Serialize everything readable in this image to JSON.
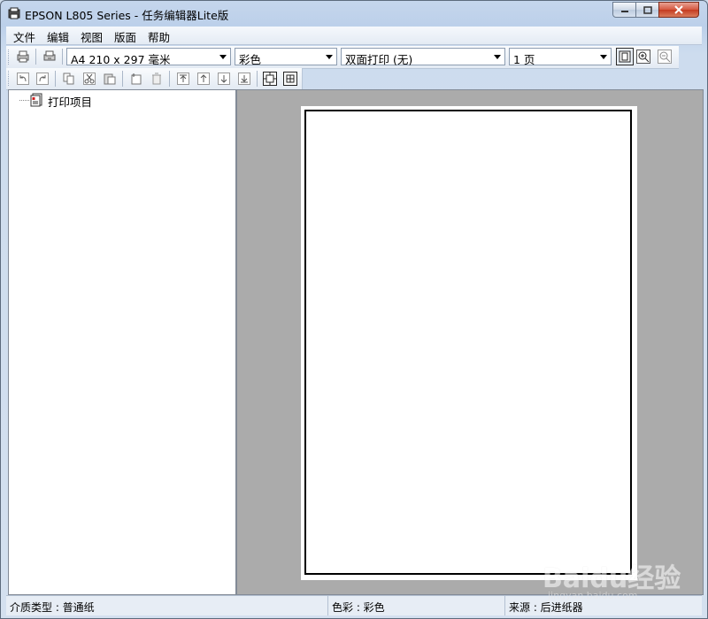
{
  "window": {
    "title": "EPSON L805 Series - 任务编辑器Lite版",
    "accent": "#c5d6ec"
  },
  "menu": {
    "items": [
      "文件",
      "编辑",
      "视图",
      "版面",
      "帮助"
    ]
  },
  "toolbar": {
    "paper_size": "A4 210 x 297 毫米",
    "color_mode": "彩色",
    "duplex": "双面打印 (无)",
    "pages": "1 页"
  },
  "tree": {
    "root_label": "打印项目"
  },
  "status": {
    "media_type": "介质类型 : 普通纸",
    "color": "色彩 : 彩色",
    "source": "来源 : 后进纸器"
  },
  "watermark": {
    "brand": "Baidu经验",
    "url": "jingyan.baidu.com"
  },
  "icons": {
    "print": "printer-icon",
    "print_settings": "print-settings-icon",
    "undo": "undo-icon",
    "redo": "redo-icon",
    "copy": "copy-icon",
    "cut": "cut-icon",
    "paste": "paste-icon",
    "new_page": "new-page-icon",
    "delete": "delete-icon",
    "move_top": "move-top-icon",
    "move_up": "move-up-icon",
    "move_down": "move-down-icon",
    "move_bottom": "move-bottom-icon",
    "fit_page": "fit-page-icon",
    "zoom_in": "zoom-in-icon",
    "zoom_out": "zoom-out-icon"
  }
}
